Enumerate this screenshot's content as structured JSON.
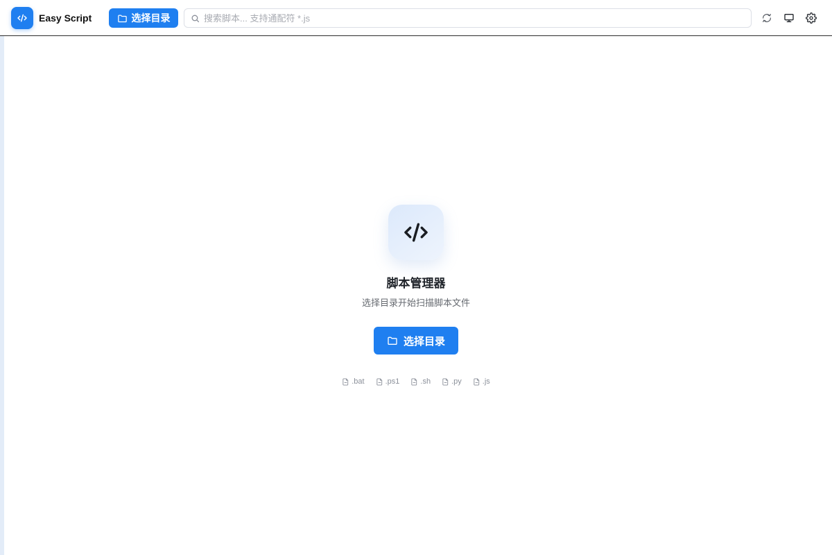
{
  "header": {
    "app_title": "Easy Script",
    "choose_dir_label": "选择目录",
    "search_placeholder": "搜索脚本... 支持通配符 *.js"
  },
  "empty_state": {
    "title": "脚本管理器",
    "subtitle": "选择目录开始扫描脚本文件",
    "choose_dir_label": "选择目录",
    "extensions": [
      ".bat",
      ".ps1",
      ".sh",
      ".py",
      ".js"
    ]
  },
  "icons": {
    "logo": "code-icon",
    "folder": "folder-icon",
    "search": "search-icon",
    "refresh": "refresh-icon",
    "monitor": "monitor-icon",
    "settings": "gear-icon",
    "file": "file-icon"
  },
  "colors": {
    "accent": "#1f7ff0",
    "hero_bg": "#e6effc",
    "muted_text": "#8a8f99"
  }
}
